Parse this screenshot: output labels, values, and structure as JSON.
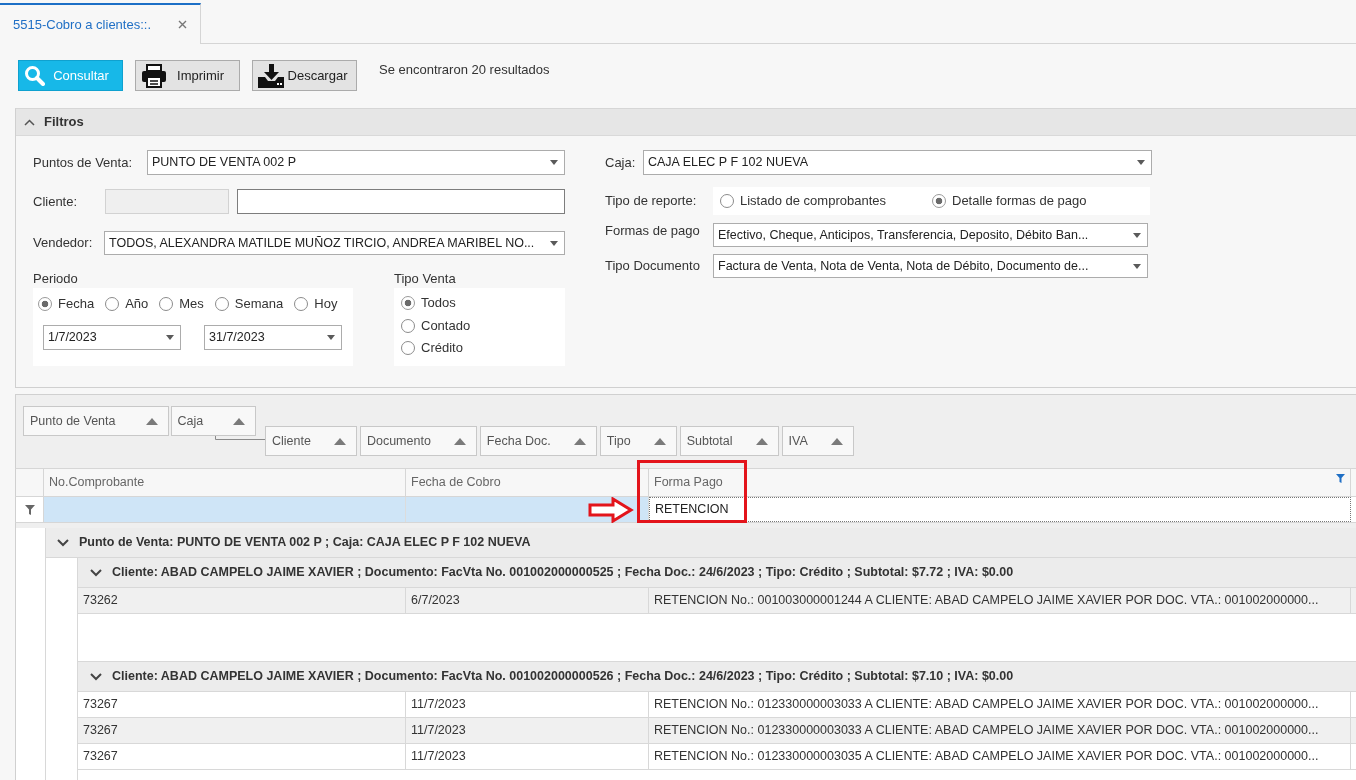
{
  "tabs": [
    {
      "label": "5515-Cobro a clientes::.",
      "selected": true
    }
  ],
  "toolbar": {
    "buttons": [
      {
        "label": "Consultar",
        "kind": "search"
      },
      {
        "label": "Imprimir",
        "kind": "print"
      },
      {
        "label": "Descargar",
        "kind": "download"
      }
    ],
    "result_text": "Se encontraron 20 resultados"
  },
  "filters": {
    "title": "Filtros",
    "expanded": true,
    "puntos_de_venta": {
      "label": "Puntos de Venta:",
      "value": "PUNTO DE VENTA 002 P"
    },
    "cliente": {
      "label": "Cliente:",
      "code_field": {
        "disabled": true
      },
      "name_field": {
        "disabled": false
      }
    },
    "vendedor": {
      "label": "Vendedor:",
      "value": "TODOS, ALEXANDRA MATILDE MUÑOZ TIRCIO, ANDREA MARIBEL NO..."
    },
    "periodo": {
      "label": "Periodo",
      "options": [
        {
          "label": "Fecha",
          "selected": true
        },
        {
          "label": "Año",
          "selected": false
        },
        {
          "label": "Mes",
          "selected": false
        },
        {
          "label": "Semana",
          "selected": false
        },
        {
          "label": "Hoy",
          "selected": false
        }
      ],
      "date_from": "1/7/2023",
      "date_to": "31/7/2023"
    },
    "tipo_venta": {
      "label": "Tipo Venta",
      "options": [
        {
          "label": "Todos",
          "selected": true
        },
        {
          "label": "Contado",
          "selected": false
        },
        {
          "label": "Crédito",
          "selected": false
        }
      ]
    },
    "caja": {
      "label": "Caja:",
      "value": "CAJA ELEC P F 102 NUEVA"
    },
    "tipo_de_reporte": {
      "label": "Tipo de reporte:",
      "options": [
        {
          "label": "Listado de comprobantes",
          "selected": false
        },
        {
          "label": "Detalle formas de pago",
          "selected": true
        }
      ]
    },
    "formas_de_pago": {
      "label": "Formas de pago",
      "value": "Efectivo, Cheque, Anticipos, Transferencia, Deposito, Débito Ban..."
    },
    "tipo_documento": {
      "label": "Tipo Documento",
      "value": "Factura de Venta, Nota de Venta, Nota de Débito, Documento de..."
    }
  },
  "grid": {
    "group_panel": [
      [
        "Punto de Venta",
        "Caja"
      ],
      [
        "Cliente",
        "Documento",
        "Fecha Doc.",
        "Tipo",
        "Subtotal",
        "IVA"
      ]
    ],
    "columns": [
      {
        "label": "No.Comprobante",
        "filtered": false
      },
      {
        "label": "Fecha de Cobro",
        "filtered": false
      },
      {
        "label": "Forma Pago",
        "filtered": true
      }
    ],
    "filter_row": [
      {
        "focused": false
      },
      {
        "focused": false
      },
      {
        "focused": true,
        "value": "RETENCION"
      }
    ],
    "annotations": {
      "frame": true,
      "arrow": true
    },
    "groups": [
      {
        "caption": "Punto de Venta: PUNTO DE VENTA 002 P ; Caja: CAJA ELEC P F 102 NUEVA",
        "expanded": true,
        "children": [
          {
            "caption": "Cliente: ABAD CAMPELO JAIME XAVIER ; Documento: FacVta No. 001002000000525 ; Fecha Doc.: 24/6/2023 ; Tipo: Crédito ; Subtotal: $7.72 ; IVA: $0.00",
            "expanded": true,
            "rows": [
              [
                "73262",
                "6/7/2023",
                "RETENCION No.: 001003000001244 A CLIENTE: ABAD CAMPELO JAIME XAVIER POR DOC. VTA.: 001002000000..."
              ]
            ]
          },
          {
            "caption": "Cliente: ABAD CAMPELO JAIME XAVIER ; Documento: FacVta No. 001002000000526 ; Fecha Doc.: 24/6/2023 ; Tipo: Crédito ; Subtotal: $7.10 ; IVA: $0.00",
            "expanded": true,
            "rows": [
              [
                "73267",
                "11/7/2023",
                "RETENCION No.: 012330000003033 A CLIENTE: ABAD CAMPELO JAIME XAVIER POR DOC. VTA.: 001002000000..."
              ],
              [
                "73267",
                "11/7/2023",
                "RETENCION No.: 012330000003033 A CLIENTE: ABAD CAMPELO JAIME XAVIER POR DOC. VTA.: 001002000000..."
              ],
              [
                "73267",
                "11/7/2023",
                "RETENCION No.: 012330000003035 A CLIENTE: ABAD CAMPELO JAIME XAVIER POR DOC. VTA.: 001002000000..."
              ]
            ]
          }
        ]
      }
    ]
  }
}
